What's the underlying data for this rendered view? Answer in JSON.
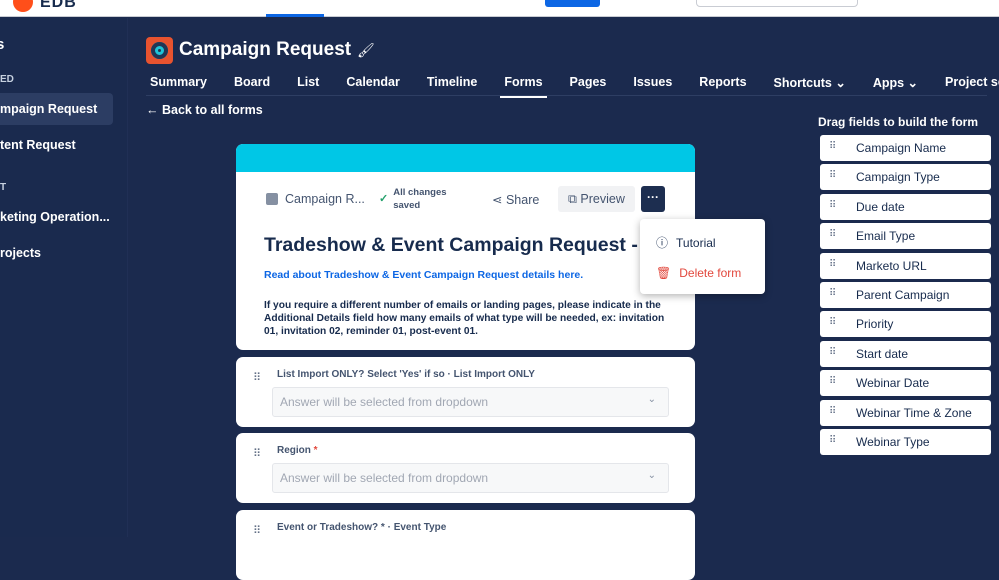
{
  "topbar": {
    "logo_text": "EDB"
  },
  "sidebar": {
    "heading": "s",
    "section1": "ED",
    "section2": "T",
    "items": [
      {
        "label": "mpaign Request",
        "active": true
      },
      {
        "label": "tent Request"
      },
      {
        "label": "keting Operation..."
      },
      {
        "label": "rojects"
      }
    ]
  },
  "project": {
    "title": "Campaign Request"
  },
  "tabs": [
    {
      "label": "Summary"
    },
    {
      "label": "Board"
    },
    {
      "label": "List"
    },
    {
      "label": "Calendar"
    },
    {
      "label": "Timeline"
    },
    {
      "label": "Forms",
      "active": true
    },
    {
      "label": "Pages"
    },
    {
      "label": "Issues"
    },
    {
      "label": "Reports"
    },
    {
      "label": "Shortcuts ⌄"
    },
    {
      "label": "Apps ⌄"
    },
    {
      "label": "Project settings"
    }
  ],
  "back_label": "Back to all forms",
  "form": {
    "crumb": "Campaign R...",
    "saved_line1": "All changes",
    "saved_line2": "saved",
    "share": "Share",
    "preview": "Preview",
    "more": "···",
    "title": "Tradeshow & Event Campaign Request - Form",
    "link": "Read about Tradeshow & Event Campaign Request details here.",
    "description": "If you require a different number of emails or landing pages, please indicate in the Additional Details field how many emails of what type will be needed, ex: invitation 01, invitation 02, reminder 01, post-event 01."
  },
  "menu": {
    "tutorial": "Tutorial",
    "delete": "Delete form"
  },
  "fields": [
    {
      "label": "List Import ONLY? Select 'Yes' if so · List Import ONLY",
      "placeholder": "Answer will be selected from dropdown"
    },
    {
      "label": "Region",
      "required": "*",
      "placeholder": "Answer will be selected from dropdown"
    },
    {
      "label": "Event or Tradeshow? * · Event Type"
    }
  ],
  "palette": {
    "heading": "Drag fields to build the form",
    "items": [
      "Campaign Name",
      "Campaign Type",
      "Due date",
      "Email Type",
      "Marketo URL",
      "Parent Campaign",
      "Priority",
      "Start date",
      "Webinar Date",
      "Webinar Time & Zone",
      "Webinar Type"
    ]
  }
}
